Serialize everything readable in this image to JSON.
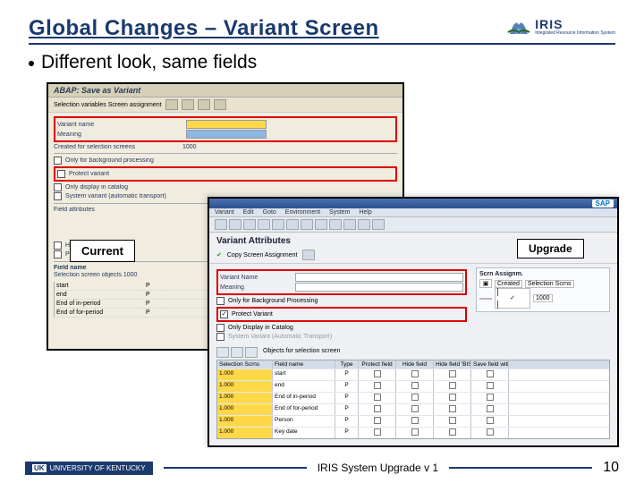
{
  "header": {
    "title": "Global Changes – Variant Screen",
    "logo_text": "IRIS",
    "logo_sub": "Integrated Resource\nInformation System"
  },
  "bullet": "Different look, same fields",
  "labels": {
    "current": "Current",
    "upgrade": "Upgrade"
  },
  "shot1": {
    "titlebar": "ABAP: Save as Variant",
    "toolbar_text": "Selection variables    Screen assignment",
    "fields": {
      "variant_name": "Variant name",
      "meaning": "Meaning",
      "created": "Created for selection screens",
      "created_val": "1000",
      "bg_only": "Only for background processing",
      "protect": "Protect variant",
      "catalog": "Only display in catalog",
      "sysvar": "System variant (automatic transport)",
      "field_attrs": "Field attributes",
      "hide_field": "Hide field",
      "protect_field": "Protect field"
    },
    "field_name_label": "Field name",
    "sel_scr_label": "Selection screen objects 1000",
    "rows": [
      "start",
      "end",
      "End of in-period",
      "End of for-period"
    ],
    "row_type": "P"
  },
  "shot2": {
    "menubar": [
      "Variant",
      "Edit",
      "Goto",
      "Environment",
      "System",
      "Help"
    ],
    "sap": "SAP",
    "heading": "Variant Attributes",
    "sub": "Copy Screen Assignment",
    "fields": {
      "variant_name": "Variant Name",
      "meaning": "Meaning",
      "bg_only": "Only for Background Processing",
      "protect": "Protect Variant",
      "catalog": "Only Display in Catalog",
      "sysvar": "System Variant (Automatic Transport)"
    },
    "screen_assign": {
      "title": "Scrn Assignm.",
      "cols": [
        "Created",
        "Selection Scrns"
      ],
      "val": "1000"
    },
    "objects_label": "Objects for selection screen",
    "grid_cols": [
      "Selection Scrns",
      "Field name",
      "Type",
      "Protect field",
      "Hide field",
      "Hide field 'BIS'",
      "Save field without values"
    ],
    "grid_rows": [
      {
        "scr": "1.000",
        "fn": "start",
        "ty": "P"
      },
      {
        "scr": "1.000",
        "fn": "end",
        "ty": "P"
      },
      {
        "scr": "1.000",
        "fn": "End of in-period",
        "ty": "P"
      },
      {
        "scr": "1.000",
        "fn": "End of for-period",
        "ty": "P"
      },
      {
        "scr": "1.000",
        "fn": "Person",
        "ty": "P"
      },
      {
        "scr": "1.000",
        "fn": "Key date",
        "ty": "P"
      }
    ]
  },
  "footer": {
    "uk": "UNIVERSITY OF KENTUCKY",
    "uk_mark": "UK",
    "center": "IRIS System Upgrade v 1",
    "page": "10"
  }
}
